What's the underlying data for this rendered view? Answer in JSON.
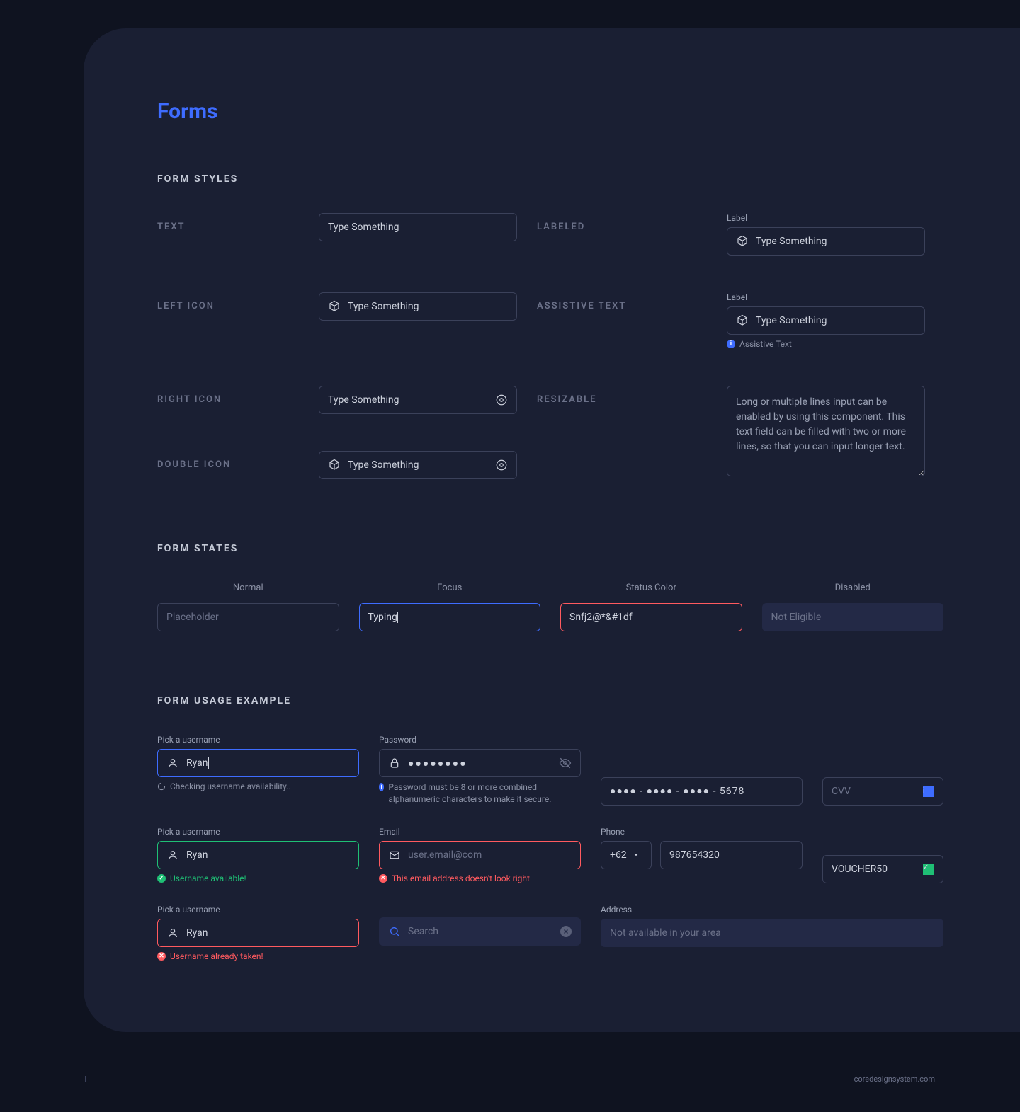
{
  "pageTitle": "Forms",
  "sections": {
    "styles": "Form Styles",
    "states": "Form States",
    "usage": "Form Usage Example"
  },
  "styleLabels": {
    "text": "TEXT",
    "leftIcon": "LEFT ICON",
    "rightIcon": "RIGHT ICON",
    "doubleIcon": "DOUBLE ICON",
    "labeled": "LABELED",
    "assistive": "ASSISTIVE TEXT",
    "resizable": "RESIZABLE"
  },
  "fieldLabel": "Label",
  "placeholder": "Type Something",
  "assistiveText": "Assistive Text",
  "resizableText": "Long or multiple lines input can be enabled by using this component. This text field can be filled with two or more lines, so that you can input longer text.",
  "states": {
    "normal": {
      "head": "Normal",
      "placeholder": "Placeholder"
    },
    "focus": {
      "head": "Focus",
      "value": "Typing"
    },
    "status": {
      "head": "Status Color",
      "value": "Snfj2@*&#1df"
    },
    "disabled": {
      "head": "Disabled",
      "value": "Not Eligible"
    }
  },
  "usage": {
    "user1": {
      "label": "Pick a username",
      "value": "Ryan",
      "msg": "Checking username availability.."
    },
    "user2": {
      "label": "Pick a username",
      "value": "Ryan",
      "msg": "Username available!"
    },
    "user3": {
      "label": "Pick a username",
      "value": "Ryan",
      "msg": "Username already taken!"
    },
    "pw": {
      "label": "Password",
      "value": "●●●●●●●●",
      "msg": "Password must be 8 or more combined alphanumeric characters to make it secure."
    },
    "email": {
      "label": "Email",
      "value": "user.email@com",
      "msg": "This email address doesn't look right"
    },
    "card": {
      "value": "●●●● - ●●●● - ●●●● - 5678"
    },
    "cvv": {
      "placeholder": "CVV"
    },
    "phone": {
      "label": "Phone",
      "cc": "+62",
      "num": "987654320"
    },
    "voucher": {
      "value": "VOUCHER50"
    },
    "search": {
      "placeholder": "Search"
    },
    "address": {
      "label": "Address",
      "value": "Not available in your area"
    }
  },
  "footer": "coredesignsystem.com"
}
